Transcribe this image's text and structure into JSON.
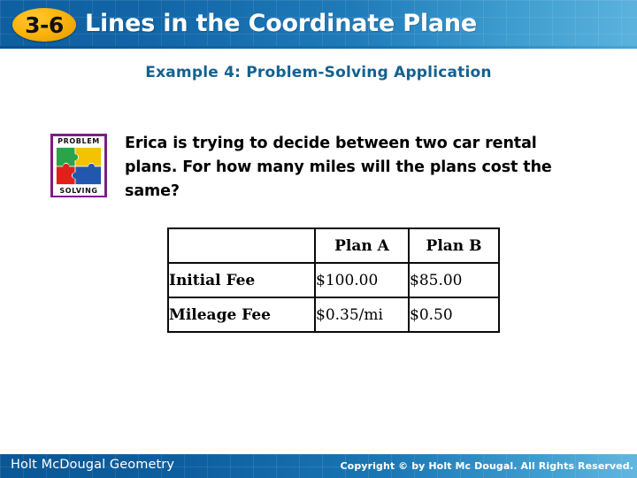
{
  "header": {
    "badge_label": "3-6",
    "title": "Lines in the Coordinate Plane",
    "badge_color": "#fcb40d",
    "bar_color_left": "#0e5fa0",
    "bar_color_right": "#5bb3dd"
  },
  "subtitle": {
    "text": "Example 4: Problem-Solving Application",
    "color": "#15618f"
  },
  "problem_icon": {
    "top_label": "PROBLEM",
    "bottom_label": "SOLVING",
    "border_color": "#7b1d86",
    "piece_colors": {
      "top_left": "#2aa34a",
      "top_right": "#f3c200",
      "bottom_left": "#e0201b",
      "bottom_right": "#2158ae"
    }
  },
  "problem": {
    "text": "Erica is trying to decide between two car rental plans. For how many miles will the plans cost the same?"
  },
  "table": {
    "headers": [
      "",
      "Plan A",
      "Plan B"
    ],
    "rows": [
      {
        "label": "Initial Fee",
        "plan_a": "$100.00",
        "plan_b": "$85.00"
      },
      {
        "label": "Mileage Fee",
        "plan_a": "$0.35/mi",
        "plan_b": "$0.50"
      }
    ]
  },
  "footer": {
    "left": "Holt McDougal Geometry",
    "right": "Copyright © by Holt Mc Dougal. All Rights Reserved."
  }
}
